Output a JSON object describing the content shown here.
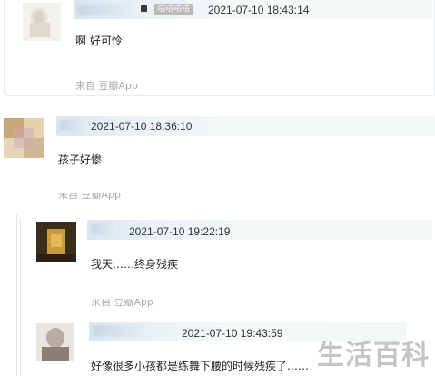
{
  "comments": [
    {
      "badge": "咕咕咕咕",
      "timestamp": "2021-07-10 18:43:14",
      "text": "啊 好可怜",
      "from": "来自 豆瓣App"
    },
    {
      "timestamp": "2021-07-10 18:36:10",
      "text": "孩子好惨",
      "from": "来自 豆瓣App"
    },
    {
      "timestamp": "2021-07-10 19:22:19",
      "text": "我天……终身残疾",
      "from": "来自 豆瓣App"
    },
    {
      "timestamp": "2021-07-10 19:43:59",
      "text": "好像很多小孩都是练舞下腰的时候残疾了……"
    }
  ],
  "watermark": "生活百科"
}
